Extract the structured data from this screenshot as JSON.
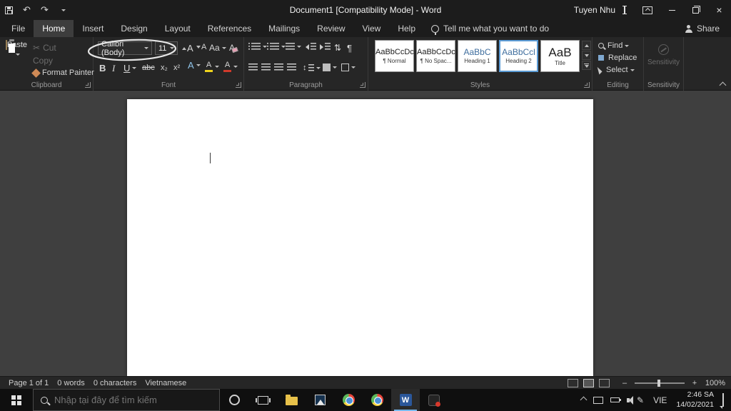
{
  "titlebar": {
    "title": "Document1 [Compatibility Mode]  -  Word",
    "user": "Tuyen Nhu"
  },
  "tabs": {
    "items": [
      "File",
      "Home",
      "Insert",
      "Design",
      "Layout",
      "References",
      "Mailings",
      "Review",
      "View",
      "Help"
    ],
    "tell_me": "Tell me what you want to do",
    "share": "Share"
  },
  "ribbon": {
    "clipboard": {
      "label": "Clipboard",
      "paste": "Paste",
      "cut": "Cut",
      "copy": "Copy",
      "format_painter": "Format Painter"
    },
    "font": {
      "label": "Font",
      "name": "Calibri (Body)",
      "size": "11",
      "bold": "B",
      "italic": "I",
      "underline": "U",
      "strikethrough": "abc",
      "subscript": "x₂",
      "superscript": "x²",
      "change_case": "Aa",
      "grow": "A",
      "shrink": "A",
      "clear": "A",
      "effects": "A",
      "highlight": "A",
      "color": "A"
    },
    "paragraph": {
      "label": "Paragraph",
      "pilcrow": "¶",
      "sort": "⇅",
      "line_spacing": "↕"
    },
    "styles": {
      "label": "Styles",
      "items": [
        {
          "sample": "AaBbCcDc",
          "name": "¶ Normal"
        },
        {
          "sample": "AaBbCcDc",
          "name": "¶ No Spac..."
        },
        {
          "sample": "AaBbC",
          "name": "Heading 1"
        },
        {
          "sample": "AaBbCcl",
          "name": "Heading 2"
        },
        {
          "sample": "AaB",
          "name": "Title"
        }
      ]
    },
    "editing": {
      "label": "Editing",
      "find": "Find",
      "replace": "Replace",
      "select": "Select"
    },
    "sensitivity": {
      "label": "Sensitivity",
      "button": "Sensitivity"
    }
  },
  "icons": {
    "undo": "↶",
    "redo": "↷",
    "cut": "✂",
    "pen": "✎",
    "close": "×"
  },
  "statusbar": {
    "page": "Page 1 of 1",
    "words": "0 words",
    "characters": "0 characters",
    "language": "Vietnamese",
    "zoom_minus": "–",
    "zoom_plus": "+",
    "zoom": "100%"
  },
  "taskbar": {
    "search_placeholder": "Nhập tại đây để tìm kiếm",
    "language": "VIE",
    "time": "2:46 SA",
    "date": "14/02/2021",
    "word_initial": "W"
  }
}
